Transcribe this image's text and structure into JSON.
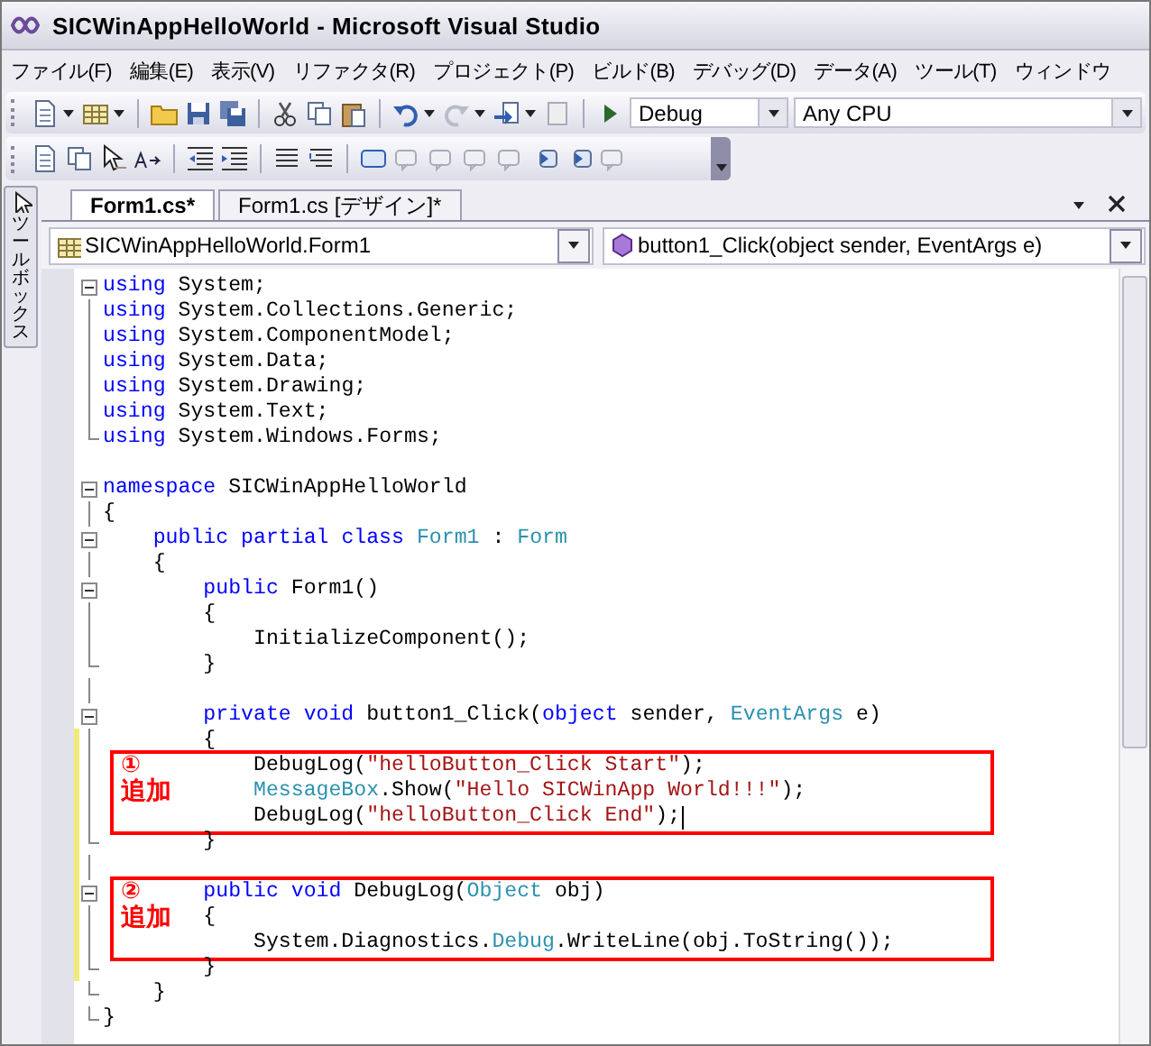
{
  "window": {
    "title": "SICWinAppHelloWorld - Microsoft Visual Studio"
  },
  "menu": [
    "ファイル(F)",
    "編集(E)",
    "表示(V)",
    "リファクタ(R)",
    "プロジェクト(P)",
    "ビルド(B)",
    "デバッグ(D)",
    "データ(A)",
    "ツール(T)",
    "ウィンドウ"
  ],
  "toolbar": {
    "configuration": "Debug",
    "platform": "Any CPU"
  },
  "toolbox_tab": "ツールボックス",
  "tabs": [
    {
      "label": "Form1.cs*",
      "selected": true
    },
    {
      "label": "Form1.cs [デザイン]*",
      "selected": false
    }
  ],
  "navigation": {
    "class_dropdown": "SICWinAppHelloWorld.Form1",
    "member_dropdown": "button1_Click(object sender, EventArgs e)"
  },
  "code": [
    {
      "kind": "line",
      "collapsible": true,
      "tokens": [
        {
          "kind": "keyword",
          "text": "using"
        },
        {
          "kind": "plain",
          "text": " System;"
        }
      ]
    },
    {
      "kind": "line",
      "in_block": true,
      "tokens": [
        {
          "kind": "keyword",
          "text": "using"
        },
        {
          "kind": "plain",
          "text": " System.Collections.Generic;"
        }
      ]
    },
    {
      "kind": "line",
      "in_block": true,
      "tokens": [
        {
          "kind": "keyword",
          "text": "using"
        },
        {
          "kind": "plain",
          "text": " System.ComponentModel;"
        }
      ]
    },
    {
      "kind": "line",
      "in_block": true,
      "tokens": [
        {
          "kind": "keyword",
          "text": "using"
        },
        {
          "kind": "plain",
          "text": " System.Data;"
        }
      ]
    },
    {
      "kind": "line",
      "in_block": true,
      "tokens": [
        {
          "kind": "keyword",
          "text": "using"
        },
        {
          "kind": "plain",
          "text": " System.Drawing;"
        }
      ]
    },
    {
      "kind": "line",
      "in_block": true,
      "tokens": [
        {
          "kind": "keyword",
          "text": "using"
        },
        {
          "kind": "plain",
          "text": " System.Text;"
        }
      ]
    },
    {
      "kind": "line",
      "block_end": true,
      "tokens": [
        {
          "kind": "keyword",
          "text": "using"
        },
        {
          "kind": "plain",
          "text": " System.Windows.Forms;"
        }
      ]
    },
    {
      "kind": "line"
    },
    {
      "kind": "line",
      "collapsible": true,
      "tokens": [
        {
          "kind": "keyword",
          "text": "namespace"
        },
        {
          "kind": "plain",
          "text": " SICWinAppHelloWorld"
        }
      ]
    },
    {
      "kind": "line",
      "in_block": true,
      "tokens": [
        {
          "kind": "plain",
          "text": "{"
        }
      ]
    },
    {
      "kind": "line",
      "collapsible": true,
      "tokens": [
        {
          "kind": "keyword",
          "text": "    public partial class"
        },
        {
          "kind": "type",
          "text": " Form1"
        },
        {
          "kind": "plain",
          "text": " : "
        },
        {
          "kind": "type",
          "text": "Form"
        }
      ]
    },
    {
      "kind": "line",
      "in_block": true,
      "tokens": [
        {
          "kind": "plain",
          "text": "    {"
        }
      ]
    },
    {
      "kind": "line",
      "collapsible": true,
      "tokens": [
        {
          "kind": "keyword",
          "text": "        public"
        },
        {
          "kind": "plain",
          "text": " Form1()"
        }
      ]
    },
    {
      "kind": "line",
      "in_block": true,
      "tokens": [
        {
          "kind": "plain",
          "text": "        {"
        }
      ]
    },
    {
      "kind": "line",
      "in_block": true,
      "tokens": [
        {
          "kind": "plain",
          "text": "            InitializeComponent();"
        }
      ]
    },
    {
      "kind": "line",
      "block_end": true,
      "tokens": [
        {
          "kind": "plain",
          "text": "        }"
        }
      ]
    },
    {
      "kind": "line",
      "in_block": true
    },
    {
      "kind": "line",
      "collapsible": true,
      "tokens": [
        {
          "kind": "keyword",
          "text": "        private void"
        },
        {
          "kind": "plain",
          "text": " button1_Click("
        },
        {
          "kind": "keyword",
          "text": "object"
        },
        {
          "kind": "plain",
          "text": " sender, "
        },
        {
          "kind": "type",
          "text": "EventArgs"
        },
        {
          "kind": "plain",
          "text": " e)"
        }
      ]
    },
    {
      "kind": "line",
      "in_block": true,
      "changed": true,
      "tokens": [
        {
          "kind": "plain",
          "text": "        {"
        }
      ]
    },
    {
      "kind": "annotated",
      "mark": "①",
      "label": "追加",
      "lines": [
        {
          "kind": "line",
          "in_block": true,
          "changed": true,
          "tokens": [
            {
              "kind": "plain",
              "text": "            DebugLog("
            },
            {
              "kind": "string",
              "text": "\"helloButton_Click Start\""
            },
            {
              "kind": "plain",
              "text": ");"
            }
          ]
        },
        {
          "kind": "line",
          "in_block": true,
          "changed": true,
          "tokens": [
            {
              "kind": "type",
              "text": "            MessageBox"
            },
            {
              "kind": "plain",
              "text": ".Show("
            },
            {
              "kind": "string",
              "text": "\"Hello SICWinApp World!!!\""
            },
            {
              "kind": "plain",
              "text": ");"
            }
          ]
        },
        {
          "kind": "line",
          "in_block": true,
          "changed": true,
          "cursor": true,
          "tokens": [
            {
              "kind": "plain",
              "text": "            DebugLog("
            },
            {
              "kind": "string",
              "text": "\"helloButton_Click End\""
            },
            {
              "kind": "plain",
              "text": ");"
            }
          ]
        }
      ]
    },
    {
      "kind": "line",
      "block_end": true,
      "changed": true,
      "tokens": [
        {
          "kind": "plain",
          "text": "        }"
        }
      ]
    },
    {
      "kind": "line",
      "in_block": true,
      "changed": true
    },
    {
      "kind": "annotated",
      "mark": "②",
      "label": "追加",
      "lines": [
        {
          "kind": "line",
          "collapsible": true,
          "changed": true,
          "tokens": [
            {
              "kind": "keyword",
              "text": "        public void"
            },
            {
              "kind": "plain",
              "text": " DebugLog("
            },
            {
              "kind": "type",
              "text": "Object"
            },
            {
              "kind": "plain",
              "text": " obj)"
            }
          ]
        },
        {
          "kind": "line",
          "in_block": true,
          "changed": true,
          "tokens": [
            {
              "kind": "plain",
              "text": "        {"
            }
          ]
        },
        {
          "kind": "line",
          "in_block": true,
          "changed": true,
          "tokens": [
            {
              "kind": "plain",
              "text": "            System.Diagnostics."
            },
            {
              "kind": "type",
              "text": "Debug"
            },
            {
              "kind": "plain",
              "text": ".WriteLine(obj.ToString());"
            }
          ]
        }
      ]
    },
    {
      "kind": "line",
      "block_end": true,
      "changed": true,
      "tokens": [
        {
          "kind": "plain",
          "text": "        }"
        }
      ]
    },
    {
      "kind": "line",
      "block_end": true,
      "tokens": [
        {
          "kind": "plain",
          "text": "    }"
        }
      ]
    },
    {
      "kind": "line",
      "block_end": true,
      "tokens": [
        {
          "kind": "plain",
          "text": "}"
        }
      ]
    }
  ]
}
